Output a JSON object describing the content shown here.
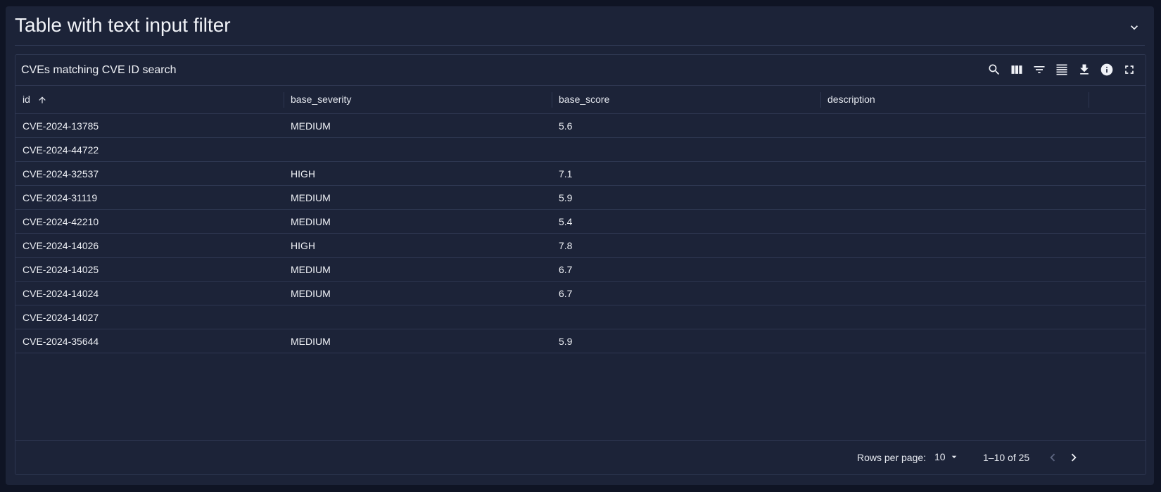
{
  "panel": {
    "title": "Table with text input filter",
    "collapse_icon": "chevron-down-icon"
  },
  "table": {
    "title": "CVEs matching CVE ID search",
    "toolbar_icons": [
      "search-icon",
      "columns-icon",
      "filter-icon",
      "density-icon",
      "download-icon",
      "info-icon",
      "fullscreen-icon"
    ],
    "columns": [
      "id",
      "base_severity",
      "base_score",
      "description"
    ],
    "sort": {
      "column": "id",
      "direction": "asc"
    },
    "rows": [
      [
        "CVE-2024-13785",
        "MEDIUM",
        "5.6",
        ""
      ],
      [
        "CVE-2024-44722",
        "",
        "",
        ""
      ],
      [
        "CVE-2024-32537",
        "HIGH",
        "7.1",
        ""
      ],
      [
        "CVE-2024-31119",
        "MEDIUM",
        "5.9",
        ""
      ],
      [
        "CVE-2024-42210",
        "MEDIUM",
        "5.4",
        ""
      ],
      [
        "CVE-2024-14026",
        "HIGH",
        "7.8",
        ""
      ],
      [
        "CVE-2024-14025",
        "MEDIUM",
        "6.7",
        ""
      ],
      [
        "CVE-2024-14024",
        "MEDIUM",
        "6.7",
        ""
      ],
      [
        "CVE-2024-14027",
        "",
        "",
        ""
      ],
      [
        "CVE-2024-35644",
        "MEDIUM",
        "5.9",
        ""
      ]
    ]
  },
  "pagination": {
    "rows_per_page_label": "Rows per page:",
    "rows_per_page": "10",
    "range": "1–10 of 25"
  },
  "colors": {
    "background": "#0f1424",
    "panel": "#1c2338",
    "border": "#2e3751",
    "text": "#eef0f5"
  }
}
